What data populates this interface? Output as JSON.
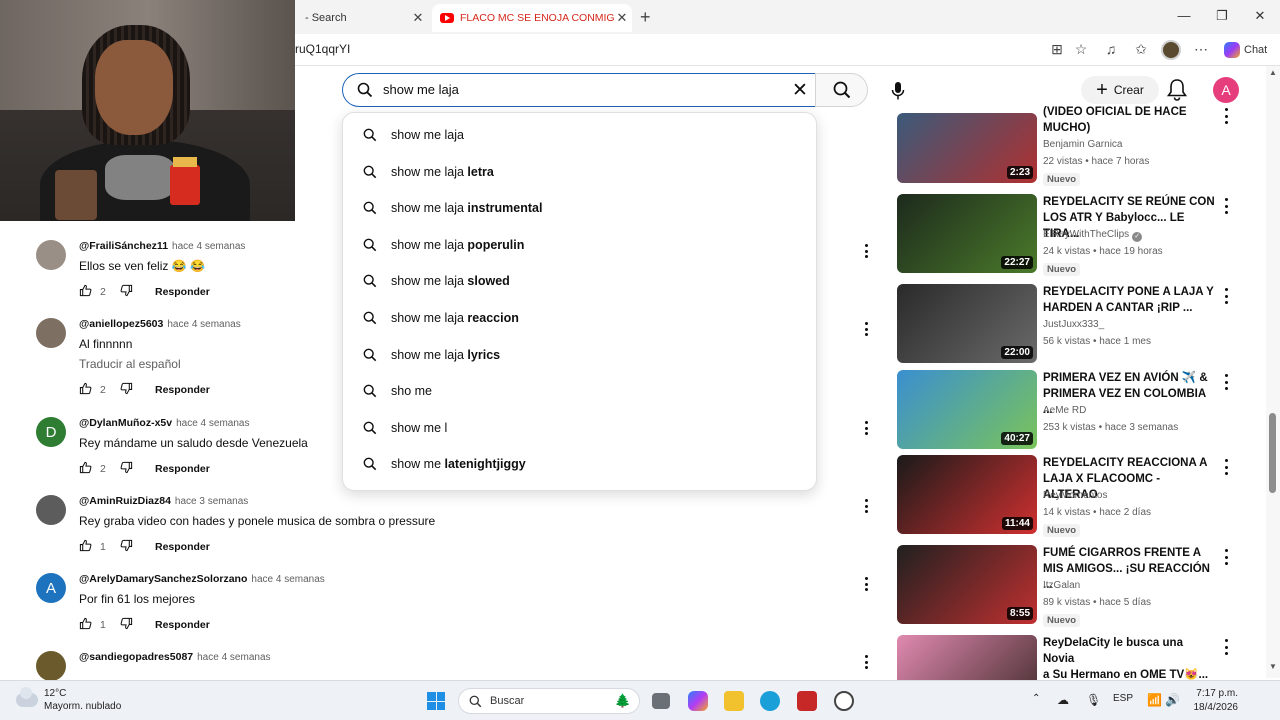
{
  "browser": {
    "tabs": [
      {
        "title": "- Search"
      },
      {
        "title": "FLACO MC SE ENOJA CONMIGO P"
      }
    ],
    "new_tab": "+",
    "url": "ruQ1qqrYI",
    "chat_label": "Chat",
    "window_controls": {
      "minimize": "—",
      "maximize": "❐",
      "close": "✕"
    }
  },
  "header": {
    "search_value": "show me laja",
    "create_label": "Crear",
    "avatar_letter": "A"
  },
  "suggestions": [
    {
      "prefix": "show me laja",
      "suffix": ""
    },
    {
      "prefix": "show me laja",
      "suffix": " letra"
    },
    {
      "prefix": "show me laja",
      "suffix": " instrumental"
    },
    {
      "prefix": "show me laja",
      "suffix": " poperulin"
    },
    {
      "prefix": "show me laja",
      "suffix": " slowed"
    },
    {
      "prefix": "show me laja",
      "suffix": " reaccion"
    },
    {
      "prefix": "show me laja",
      "suffix": " lyrics"
    },
    {
      "prefix": "sho me",
      "suffix": ""
    },
    {
      "prefix": "show me l",
      "suffix": ""
    },
    {
      "prefix": "show me ",
      "suffix": "latenightjiggy"
    }
  ],
  "comments": [
    {
      "author": "@FrailiSánchez11",
      "time": "hace 4 semanas",
      "text": "Ellos se ven feliz 😂 😂",
      "likes": "2",
      "reply": "Responder",
      "avatar_color": "#9a8f86",
      "avatar_letter": ""
    },
    {
      "author": "@aniellopez5603",
      "time": "hace 4 semanas",
      "text": "Al finnnnn",
      "translate": "Traducir al español",
      "likes": "2",
      "reply": "Responder",
      "avatar_color": "#7d6f62",
      "avatar_letter": ""
    },
    {
      "author": "@DylanMuñoz-x5v",
      "time": "hace 4 semanas",
      "text": "Rey mándame un saludo desde Venezuela",
      "likes": "2",
      "reply": "Responder",
      "avatar_color": "#2e7d32",
      "avatar_letter": "D"
    },
    {
      "author": "@AminRuizDiaz84",
      "time": "hace 3 semanas",
      "text": "Rey graba video con hades y ponele musica de sombra o pressure",
      "likes": "1",
      "reply": "Responder",
      "avatar_color": "#5c5c5c",
      "avatar_letter": ""
    },
    {
      "author": "@ArelyDamarySanchezSolorzano",
      "time": "hace 4 semanas",
      "text": "Por fin 61 los mejores",
      "likes": "1",
      "reply": "Responder",
      "avatar_color": "#1e73be",
      "avatar_letter": "A"
    },
    {
      "author": "@sandiegopadres5087",
      "time": "hace 4 semanas",
      "text": "",
      "likes": "",
      "reply": "",
      "avatar_color": "#6b5a2c",
      "avatar_letter": ""
    }
  ],
  "videos": [
    {
      "title": "(VIDEO OFICIAL DE HACE\nMUCHO)",
      "channel": "Benjamin Garnica",
      "meta": "22 vistas • hace 7 horas",
      "badge": "Nuevo",
      "duration": "2:23",
      "colors": [
        "#3a5a7a",
        "#b03030"
      ]
    },
    {
      "title": "REYDELACITY SE REÚNE CON\nLOS ATR Y Babylocc... LE TIRA...",
      "channel": "ElReyWithTheClips",
      "verified": true,
      "meta": "24 k vistas • hace 19 horas",
      "badge": "Nuevo",
      "duration": "22:27",
      "colors": [
        "#1d2a1d",
        "#4a7a2a"
      ]
    },
    {
      "title": "REYDELACITY PONE A LAJA Y\nHARDEN A CANTAR ¡RIP ...",
      "channel": "JustJuxx333_",
      "meta": "56 k vistas • hace 1 mes",
      "badge": "",
      "duration": "22:00",
      "colors": [
        "#2a2a2a",
        "#6a6a6a"
      ]
    },
    {
      "title": "PRIMERA VEZ EN AVIÓN ✈️ &\nPRIMERA VEZ EN COLOMBIA ...",
      "channel": "AeMe RD",
      "meta": "253 k vistas • hace 3 semanas",
      "badge": "",
      "duration": "40:27",
      "colors": [
        "#3a8fd0",
        "#7ac45a"
      ]
    },
    {
      "title": "REYDELACITY REACCIONA A\nLAJA X FLACOOMC - ALTERAO",
      "channel": "ReyMomentos",
      "meta": "14 k vistas • hace 2 días",
      "badge": "Nuevo",
      "duration": "11:44",
      "colors": [
        "#1a1a1a",
        "#d03030"
      ]
    },
    {
      "title": "FUMÉ CIGARROS FRENTE A\nMIS AMIGOS... ¡SU REACCIÓN ...",
      "channel": "ItzGalan",
      "meta": "89 k vistas • hace 5 días",
      "badge": "Nuevo",
      "duration": "8:55",
      "colors": [
        "#202020",
        "#c03030"
      ]
    },
    {
      "title": "ReyDelaCity le busca una Novia\na Su Hermano en OME TV😻...",
      "channel": "",
      "meta": "",
      "badge": "",
      "duration": "",
      "colors": [
        "#e08ab0",
        "#402a2a"
      ]
    }
  ],
  "taskbar": {
    "temperature": "12°C",
    "weather": "Mayorm. nublado",
    "search_placeholder": "Buscar",
    "language": "ESP",
    "time": "7:17 p.m.",
    "date": "18/4/2026"
  }
}
